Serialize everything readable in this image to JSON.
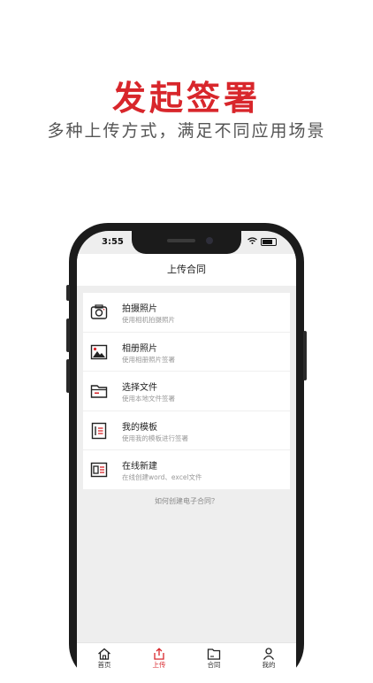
{
  "promo": {
    "title": "发起签署",
    "subtitle": "多种上传方式，满足不同应用场景"
  },
  "status_bar": {
    "time": "3:55"
  },
  "header": {
    "title": "上传合同"
  },
  "menu": [
    {
      "title": "拍摄照片",
      "desc": "使用相机拍摄照片",
      "icon": "camera-icon"
    },
    {
      "title": "相册照片",
      "desc": "使用相册照片签署",
      "icon": "photo-album-icon"
    },
    {
      "title": "选择文件",
      "desc": "使用本地文件签署",
      "icon": "folder-icon"
    },
    {
      "title": "我的模板",
      "desc": "使用我的模板进行签署",
      "icon": "template-icon"
    },
    {
      "title": "在线新建",
      "desc": "在线创建word、excel文件",
      "icon": "create-online-icon"
    }
  ],
  "help_link": "如何创建电子合同？",
  "tabs": [
    {
      "label": "首页",
      "icon": "home-icon"
    },
    {
      "label": "上传",
      "icon": "upload-icon",
      "active": true
    },
    {
      "label": "合同",
      "icon": "contract-folder-icon"
    },
    {
      "label": "我的",
      "icon": "user-icon"
    }
  ],
  "colors": {
    "accent": "#d8262b",
    "text_dark": "#222222",
    "text_muted": "#999999",
    "page_bg": "#eeeeee"
  }
}
